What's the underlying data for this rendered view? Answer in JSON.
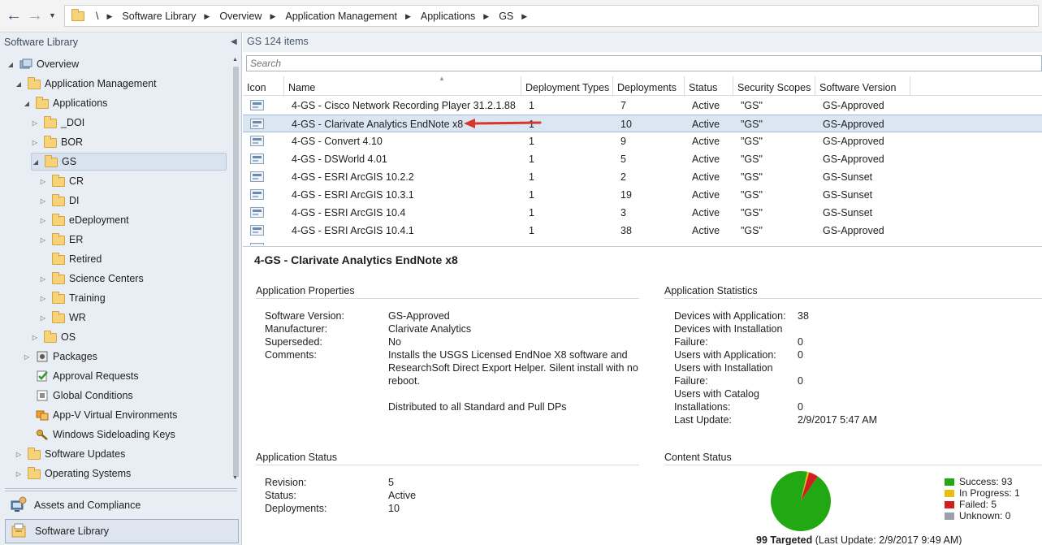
{
  "address_bar": {
    "crumbs": [
      "\\",
      "Software Library",
      "Overview",
      "Application Management",
      "Applications",
      "GS"
    ]
  },
  "left_pane": {
    "title": "Software Library",
    "tree": [
      {
        "label": "Overview",
        "icon": "overview-icon",
        "expander": "◢"
      },
      {
        "label": "Application Management",
        "icon": "folder-icon",
        "expander": "◢"
      },
      {
        "label": "Applications",
        "icon": "folder-icon",
        "expander": "◢"
      },
      {
        "label": "_DOI",
        "icon": "folder-icon",
        "expander": "▷"
      },
      {
        "label": "BOR",
        "icon": "folder-icon",
        "expander": "▷"
      },
      {
        "label": "GS",
        "icon": "folder-icon",
        "expander": "◢"
      },
      {
        "label": "CR",
        "icon": "folder-icon",
        "expander": "▷"
      },
      {
        "label": "DI",
        "icon": "folder-icon",
        "expander": "▷"
      },
      {
        "label": "eDeployment",
        "icon": "folder-icon",
        "expander": "▷"
      },
      {
        "label": "ER",
        "icon": "folder-icon",
        "expander": "▷"
      },
      {
        "label": "Retired",
        "icon": "folder-icon",
        "expander": ""
      },
      {
        "label": "Science Centers",
        "icon": "folder-icon",
        "expander": "▷"
      },
      {
        "label": "Training",
        "icon": "folder-icon",
        "expander": "▷"
      },
      {
        "label": "WR",
        "icon": "folder-icon",
        "expander": "▷"
      },
      {
        "label": "OS",
        "icon": "folder-icon",
        "expander": "▷"
      },
      {
        "label": "Packages",
        "icon": "package-icon",
        "expander": "▷"
      },
      {
        "label": "Approval Requests",
        "icon": "approval-icon",
        "expander": ""
      },
      {
        "label": "Global Conditions",
        "icon": "conditions-icon",
        "expander": ""
      },
      {
        "label": "App-V Virtual Environments",
        "icon": "appv-icon",
        "expander": ""
      },
      {
        "label": "Windows Sideloading Keys",
        "icon": "key-icon",
        "expander": ""
      },
      {
        "label": "Software Updates",
        "icon": "folder-icon",
        "expander": "▷"
      },
      {
        "label": "Operating Systems",
        "icon": "folder-icon",
        "expander": "▷"
      }
    ],
    "workspaces": [
      {
        "label": "Assets and Compliance",
        "icon": "assets-icon"
      },
      {
        "label": "Software Library",
        "icon": "software-library-icon"
      }
    ]
  },
  "right_pane": {
    "title": "GS 124 items",
    "search_placeholder": "Search",
    "columns": [
      "Icon",
      "Name",
      "Deployment Types",
      "Deployments",
      "Status",
      "Security Scopes",
      "Software Version"
    ],
    "rows": [
      {
        "name": "4-GS - Cisco Network Recording Player 31.2.1.88",
        "deployment_types": "1",
        "deployments": "7",
        "status": "Active",
        "scopes": "\"GS\"",
        "version": "GS-Approved"
      },
      {
        "name": "4-GS - Clarivate Analytics EndNote x8",
        "deployment_types": "1",
        "deployments": "10",
        "status": "Active",
        "scopes": "\"GS\"",
        "version": "GS-Approved"
      },
      {
        "name": "4-GS - Convert 4.10",
        "deployment_types": "1",
        "deployments": "9",
        "status": "Active",
        "scopes": "\"GS\"",
        "version": "GS-Approved"
      },
      {
        "name": "4-GS - DSWorld 4.01",
        "deployment_types": "1",
        "deployments": "5",
        "status": "Active",
        "scopes": "\"GS\"",
        "version": "GS-Approved"
      },
      {
        "name": "4-GS - ESRI ArcGIS 10.2.2",
        "deployment_types": "1",
        "deployments": "2",
        "status": "Active",
        "scopes": "\"GS\"",
        "version": "GS-Sunset"
      },
      {
        "name": "4-GS - ESRI ArcGIS 10.3.1",
        "deployment_types": "1",
        "deployments": "19",
        "status": "Active",
        "scopes": "\"GS\"",
        "version": "GS-Sunset"
      },
      {
        "name": "4-GS - ESRI ArcGIS 10.4",
        "deployment_types": "1",
        "deployments": "3",
        "status": "Active",
        "scopes": "\"GS\"",
        "version": "GS-Sunset"
      },
      {
        "name": "4-GS - ESRI ArcGIS 10.4.1",
        "deployment_types": "1",
        "deployments": "38",
        "status": "Active",
        "scopes": "\"GS\"",
        "version": "GS-Approved"
      }
    ],
    "selected_row": 1
  },
  "details": {
    "title": "4-GS - Clarivate Analytics EndNote x8",
    "app_properties": {
      "heading": "Application Properties",
      "software_version_label": "Software Version:",
      "software_version": "GS-Approved",
      "manufacturer_label": "Manufacturer:",
      "manufacturer": "Clarivate Analytics",
      "superseded_label": "Superseded:",
      "superseded": "No",
      "comments_label": "Comments:",
      "comments_line1": "Installs the USGS Licensed EndNoe X8 software and",
      "comments_line2": "ResearchSoft Direct Export Helper.  Silent install with no",
      "comments_line3": "reboot.",
      "comments_line4": "Distributed to all Standard and Pull DPs"
    },
    "app_statistics": {
      "heading": "Application Statistics",
      "devices_with_app_label": "Devices with Application:",
      "devices_with_app": "38",
      "devices_install_failure_label1": "Devices with Installation",
      "devices_install_failure_label2": "Failure:",
      "devices_install_failure": "0",
      "users_with_app_label": "Users with Application:",
      "users_with_app": "0",
      "users_install_failure_label1": "Users with Installation",
      "users_install_failure_label2": "Failure:",
      "users_install_failure": "0",
      "users_catalog_label1": "Users with Catalog",
      "users_catalog_label2": "Installations:",
      "users_catalog": "0",
      "last_update_label": "Last Update:",
      "last_update": "2/9/2017 5:47 AM"
    },
    "app_status": {
      "heading": "Application Status",
      "revision_label": "Revision:",
      "revision": "5",
      "status_label": "Status:",
      "status": "Active",
      "deployments_label": "Deployments:",
      "deployments": "10"
    },
    "content_status": {
      "heading": "Content Status",
      "targeted": "99 Targeted",
      "last_update": "(Last Update: 2/9/2017 9:49 AM)",
      "legend": [
        {
          "label": "Success: 93",
          "value": 93,
          "color": "#22a812"
        },
        {
          "label": "In Progress: 1",
          "value": 1,
          "color": "#e3c10d"
        },
        {
          "label": "Failed: 5",
          "value": 5,
          "color": "#d21e1e"
        },
        {
          "label": "Unknown: 0",
          "value": 0,
          "color": "#9aa0a6"
        }
      ]
    }
  },
  "colors": {
    "selection": "#dbe6f3",
    "annotation_arrow": "#d9362c"
  }
}
